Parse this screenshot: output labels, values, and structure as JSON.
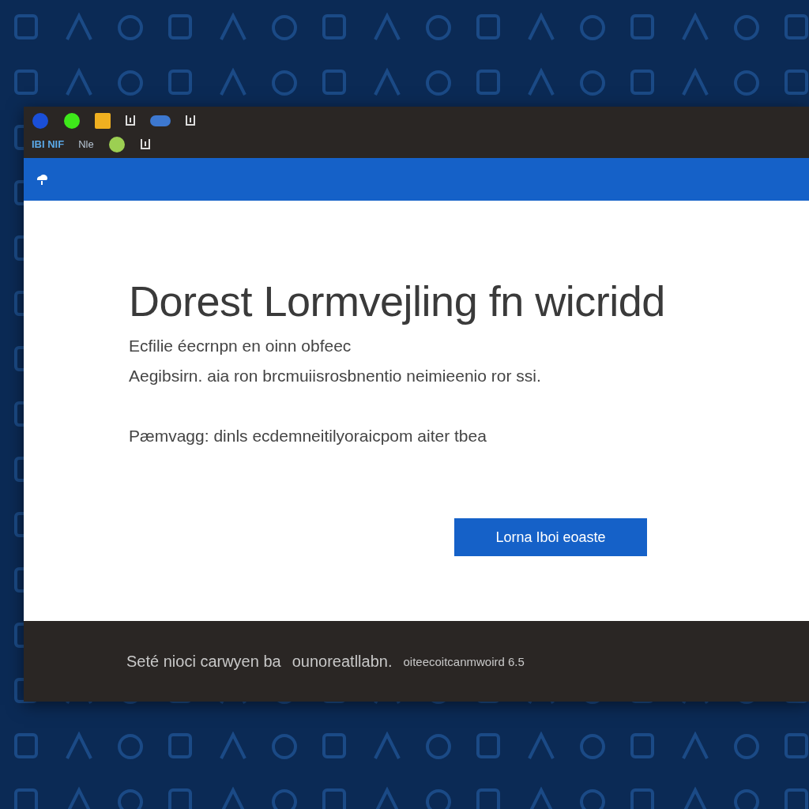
{
  "titlebar": {
    "row_1_icons": [
      {
        "kind": "dot",
        "color": "#1a4fd8"
      },
      {
        "kind": "dot",
        "color": "#3ee81a"
      },
      {
        "kind": "square",
        "color": "#f0b020"
      },
      {
        "kind": "glyph"
      },
      {
        "kind": "pill",
        "color": "#3d78d0"
      },
      {
        "kind": "glyph"
      }
    ],
    "row_2_labels": [
      "IBI NIF",
      "Nle"
    ],
    "row_2_icons": [
      {
        "kind": "dot",
        "color": "#9ccf52"
      },
      {
        "kind": "glyph"
      }
    ]
  },
  "content": {
    "heading": "Dorest Lormvejling fn wicridd",
    "lines": [
      "Ecfilie éecrnpn en oinn obfeec",
      "Aegibsirn. aia ron brcmuiisrosbnentio neimieenio ror ssi."
    ],
    "note": "Pæmvagg: dinls ecdemneitilyoraicpom aiter tbea",
    "button": "Lorna Iboi eoaste"
  },
  "footer": [
    "Seté nioci carwyen ba",
    "ounoreatllabn.",
    "oiteecoitcanmwoird 6.5"
  ]
}
